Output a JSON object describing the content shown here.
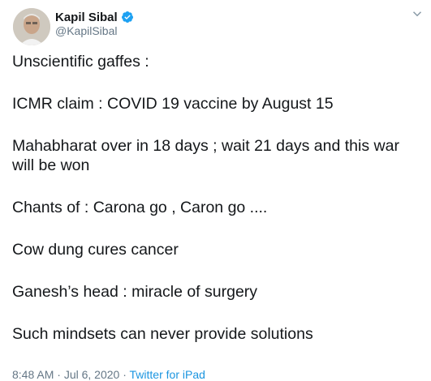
{
  "author": {
    "display_name": "Kapil Sibal",
    "handle": "@KapilSibal",
    "verified": true
  },
  "tweet": {
    "lines": [
      "Unscientific gaffes :",
      "ICMR claim : COVID 19 vaccine by August 15",
      "Mahabharat over in 18 days ; wait 21 days and this war will be won",
      "Chants of : Carona go , Caron go ....",
      "Cow dung cures cancer",
      "Ganesh’s head : miracle of surgery",
      "Such mindsets can never provide solutions"
    ]
  },
  "meta": {
    "time": "8:48 AM",
    "date": "Jul 6, 2020",
    "separator": "·",
    "source": "Twitter for iPad"
  },
  "colors": {
    "text": "#14171a",
    "secondary": "#657786",
    "verified": "#1da1f2",
    "link": "#1b95e0"
  },
  "icons": {
    "verified": "verified-badge-icon",
    "more": "chevron-down-icon"
  }
}
